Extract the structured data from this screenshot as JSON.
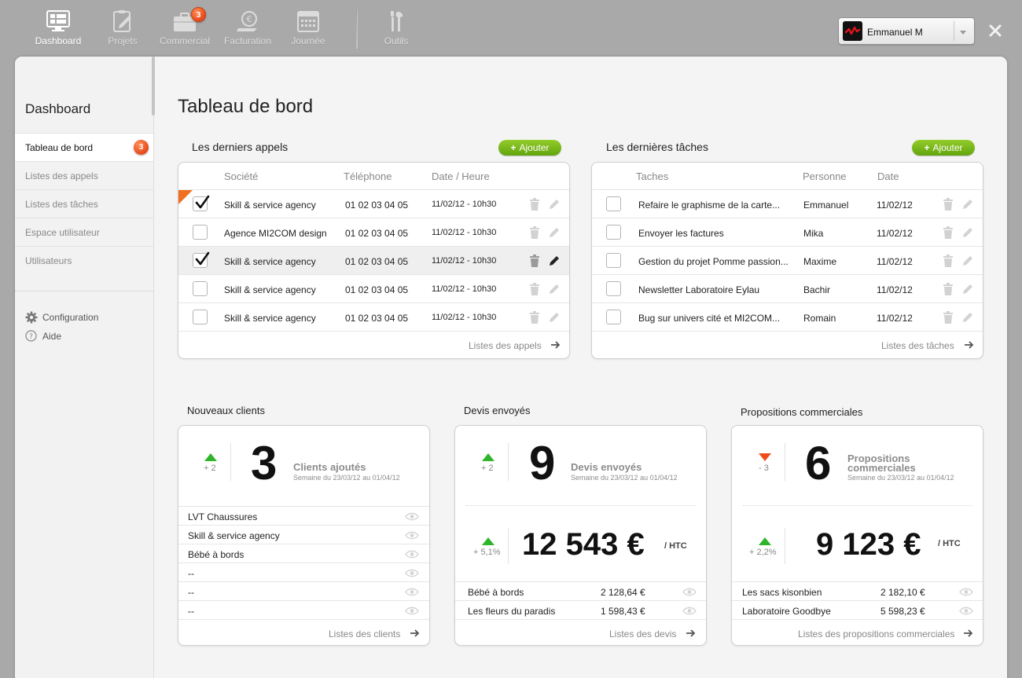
{
  "nav": {
    "items": [
      {
        "label": "Dashboard",
        "icon": "dashboard-icon"
      },
      {
        "label": "Projets",
        "icon": "projects-icon"
      },
      {
        "label": "Commercial",
        "icon": "briefcase-icon",
        "badge": "3"
      },
      {
        "label": "Facturation",
        "icon": "billing-icon"
      },
      {
        "label": "Journée",
        "icon": "calendar-icon"
      },
      {
        "label": "Outils",
        "icon": "tools-icon"
      }
    ],
    "user": "Emmanuel M"
  },
  "sidebar": {
    "title": "Dashboard",
    "items": [
      {
        "label": "Tableau de bord",
        "badge": "3"
      },
      {
        "label": "Listes des appels"
      },
      {
        "label": "Listes des tâches"
      },
      {
        "label": "Espace utilisateur"
      },
      {
        "label": "Utilisateurs"
      }
    ],
    "config": "Configuration",
    "help": "Aide"
  },
  "page": {
    "title": "Tableau de bord"
  },
  "calls": {
    "title": "Les derniers appels",
    "add": "Ajouter",
    "headers": [
      "Société",
      "Téléphone",
      "Date / Heure"
    ],
    "rows": [
      {
        "company": "Skill & service agency",
        "phone": "01 02 03 04 05",
        "date": "11/02/12 - 10h30",
        "checked": true
      },
      {
        "company": "Agence MI2COM design",
        "phone": "01 02 03 04 05",
        "date": "11/02/12 - 10h30",
        "checked": false
      },
      {
        "company": "Skill & service agency",
        "phone": "01 02 03 04 05",
        "date": "11/02/12 - 10h30",
        "checked": true
      },
      {
        "company": "Skill & service agency",
        "phone": "01 02 03 04 05",
        "date": "11/02/12 - 10h30",
        "checked": false
      },
      {
        "company": "Skill & service agency",
        "phone": "01 02 03 04 05",
        "date": "11/02/12 - 10h30",
        "checked": false
      }
    ],
    "footer": "Listes des appels"
  },
  "tasks": {
    "title": "Les dernières tâches",
    "add": "Ajouter",
    "headers": [
      "Taches",
      "Personne",
      "Date"
    ],
    "rows": [
      {
        "task": "Refaire le graphisme de la carte...",
        "person": "Emmanuel",
        "date": "11/02/12"
      },
      {
        "task": "Envoyer les factures",
        "person": "Mika",
        "date": "11/02/12"
      },
      {
        "task": "Gestion du projet Pomme passion...",
        "person": "Maxime",
        "date": "11/02/12"
      },
      {
        "task": "Newsletter Laboratoire Eylau",
        "person": "Bachir",
        "date": "11/02/12"
      },
      {
        "task": "Bug sur univers cité et MI2COM...",
        "person": "Romain",
        "date": "11/02/12"
      }
    ],
    "footer": "Listes des tâches"
  },
  "clients": {
    "title": "Nouveaux clients",
    "delta": "+ 2",
    "value": "3",
    "label": "Clients ajoutés",
    "sub": "Semaine du 23/03/12 au 01/04/12",
    "rows": [
      "LVT Chaussures",
      "Skill & service agency",
      "Bébé à bords",
      "--",
      "--",
      "--"
    ],
    "footer": "Listes des clients"
  },
  "devis": {
    "title": "Devis envoyés",
    "delta": "+ 2",
    "value": "9",
    "label": "Devis envoyés",
    "sub": "Semaine du 23/03/12 au 01/04/12",
    "money_delta": "+ 5,1%",
    "money": "12 543 €",
    "unit": "/ HTC",
    "rows": [
      {
        "name": "Bébé à bords",
        "amount": "2 128,64 €"
      },
      {
        "name": "Les fleurs du paradis",
        "amount": "1 598,43 €"
      }
    ],
    "footer": "Listes des devis"
  },
  "props": {
    "title": "Propositions commerciales",
    "delta": "- 3",
    "value": "6",
    "label_line1": "Propositions",
    "label_line2": "commerciales",
    "sub": "Semaine du 23/03/12 au 01/04/12",
    "money_delta": "+ 2,2%",
    "money": "9 123 €",
    "unit": "/ HTC",
    "rows": [
      {
        "name": "Les sacs kisonbien",
        "amount": "2 182,10 €"
      },
      {
        "name": "Laboratoire Goodbye",
        "amount": "5 598,23 €"
      }
    ],
    "footer": "Listes des propositions commerciales"
  }
}
